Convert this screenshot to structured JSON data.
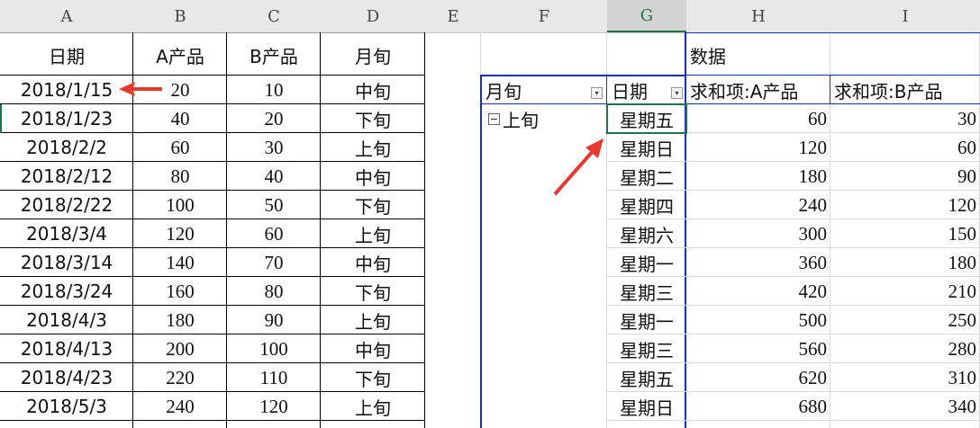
{
  "columns": [
    "A",
    "B",
    "C",
    "D",
    "E",
    "F",
    "G",
    "H",
    "I"
  ],
  "headers": {
    "date": "日期",
    "a": "A产品",
    "b": "B产品",
    "period": "月旬"
  },
  "rows": [
    {
      "date": "2018/1/15",
      "a": "20",
      "b": "10",
      "period": "中旬"
    },
    {
      "date": "2018/1/23",
      "a": "40",
      "b": "20",
      "period": "下旬"
    },
    {
      "date": "2018/2/2",
      "a": "60",
      "b": "30",
      "period": "上旬"
    },
    {
      "date": "2018/2/12",
      "a": "80",
      "b": "40",
      "period": "中旬"
    },
    {
      "date": "2018/2/22",
      "a": "100",
      "b": "50",
      "period": "下旬"
    },
    {
      "date": "2018/3/4",
      "a": "120",
      "b": "60",
      "period": "上旬"
    },
    {
      "date": "2018/3/14",
      "a": "140",
      "b": "70",
      "period": "中旬"
    },
    {
      "date": "2018/3/24",
      "a": "160",
      "b": "80",
      "period": "下旬"
    },
    {
      "date": "2018/4/3",
      "a": "180",
      "b": "90",
      "period": "上旬"
    },
    {
      "date": "2018/4/13",
      "a": "200",
      "b": "100",
      "period": "中旬"
    },
    {
      "date": "2018/4/23",
      "a": "220",
      "b": "110",
      "period": "下旬"
    },
    {
      "date": "2018/5/3",
      "a": "240",
      "b": "120",
      "period": "上旬"
    }
  ],
  "pivot": {
    "data_label": "数据",
    "row_field_1": "月旬",
    "row_field_2": "日期",
    "value_1": "求和项:A产品",
    "value_2": "求和项:B产品",
    "group": "上旬",
    "rows": [
      {
        "day": "星期五",
        "a": "60",
        "b": "30"
      },
      {
        "day": "星期日",
        "a": "120",
        "b": "60"
      },
      {
        "day": "星期二",
        "a": "180",
        "b": "90"
      },
      {
        "day": "星期四",
        "a": "240",
        "b": "120"
      },
      {
        "day": "星期六",
        "a": "300",
        "b": "150"
      },
      {
        "day": "星期一",
        "a": "360",
        "b": "180"
      },
      {
        "day": "星期三",
        "a": "420",
        "b": "210"
      },
      {
        "day": "星期一",
        "a": "500",
        "b": "250"
      },
      {
        "day": "星期三",
        "a": "560",
        "b": "280"
      },
      {
        "day": "星期五",
        "a": "620",
        "b": "310"
      },
      {
        "day": "星期日",
        "a": "680",
        "b": "340"
      }
    ]
  },
  "colors": {
    "pivot_border": "#1a2dbd",
    "selection": "#217346",
    "arrow": "#e8392f"
  },
  "icons": [
    "dropdown-filter-icon",
    "dropdown-arrow-icon",
    "collapse-minus-icon",
    "red-arrow-annotation"
  ]
}
